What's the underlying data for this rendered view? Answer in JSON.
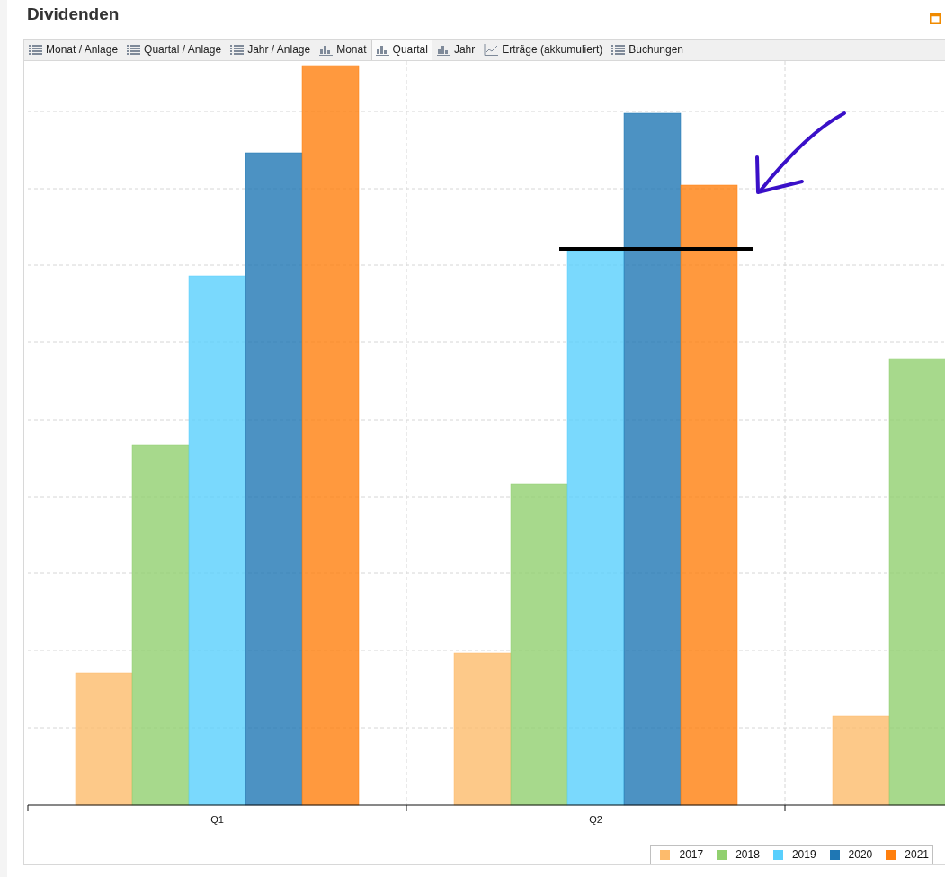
{
  "panel": {
    "title": "Dividenden"
  },
  "tabs": [
    {
      "label": "Monat / Anlage",
      "kind": "list",
      "selected": false
    },
    {
      "label": "Quartal / Anlage",
      "kind": "list",
      "selected": false
    },
    {
      "label": "Jahr / Anlage",
      "kind": "list",
      "selected": false
    },
    {
      "label": "Monat",
      "kind": "bar",
      "selected": false
    },
    {
      "label": "Quartal",
      "kind": "bar",
      "selected": true
    },
    {
      "label": "Jahr",
      "kind": "bar",
      "selected": false
    },
    {
      "label": "Erträge (akkumuliert)",
      "kind": "line",
      "selected": false
    },
    {
      "label": "Buchungen",
      "kind": "list",
      "selected": false
    }
  ],
  "chart": {
    "x_labels": [
      "Q1",
      "Q2"
    ],
    "legend": [
      {
        "label": "2017",
        "color": "#fdbb6c"
      },
      {
        "label": "2018",
        "color": "#91d06f"
      },
      {
        "label": "2019",
        "color": "#59cffd"
      },
      {
        "label": "2020",
        "color": "#1f77b4"
      },
      {
        "label": "2021",
        "color": "#ff7f0e"
      }
    ]
  }
}
